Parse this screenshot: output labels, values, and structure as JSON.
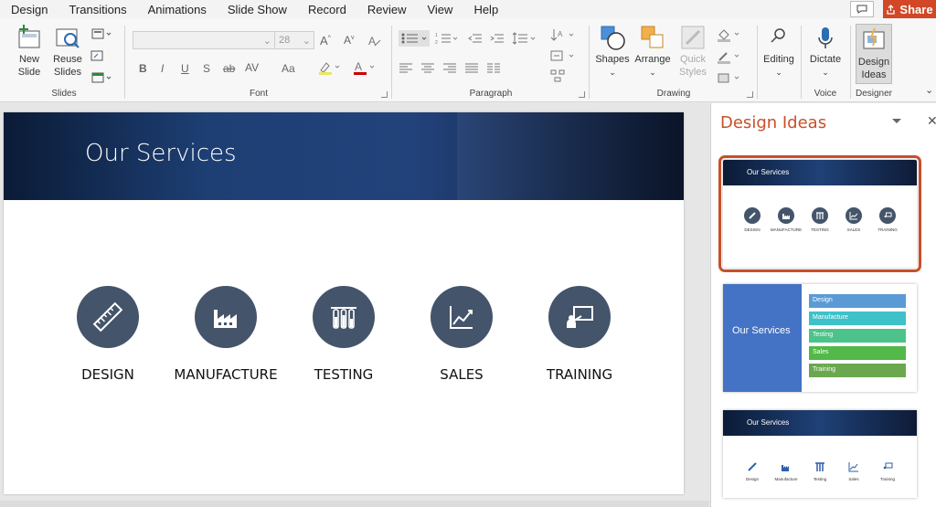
{
  "menu": {
    "items": [
      "Design",
      "Transitions",
      "Animations",
      "Slide Show",
      "Record",
      "Review",
      "View",
      "Help"
    ],
    "share_label": "Share"
  },
  "ribbon": {
    "slides_group": {
      "name": "Slides",
      "new_slide": "New Slide",
      "reuse_slides": "Reuse Slides"
    },
    "font_group": {
      "name": "Font",
      "font_size": "28",
      "bold": "B",
      "italic": "I",
      "underline": "U",
      "shadow": "S",
      "strike": "ab",
      "spacing": "AV",
      "case": "Aa"
    },
    "paragraph_group": {
      "name": "Paragraph"
    },
    "drawing_group": {
      "name": "Drawing",
      "shapes": "Shapes",
      "arrange": "Arrange",
      "quick_styles": "Quick Styles"
    },
    "editing_group": {
      "label": "Editing"
    },
    "voice_group": {
      "name": "Voice",
      "dictate": "Dictate"
    },
    "designer_group": {
      "name": "Designer",
      "design_ideas": "Design Ideas"
    }
  },
  "slide": {
    "title": "Our Services",
    "services": [
      {
        "label": "DESIGN",
        "icon": "ruler-icon"
      },
      {
        "label": "MANUFACTURE",
        "icon": "factory-icon"
      },
      {
        "label": "TESTING",
        "icon": "test-tubes-icon"
      },
      {
        "label": "SALES",
        "icon": "chart-icon"
      },
      {
        "label": "TRAINING",
        "icon": "presentation-icon"
      }
    ]
  },
  "pane": {
    "title": "Design Ideas",
    "thumb1": {
      "title": "Our Services",
      "labels": [
        "DESIGN",
        "MANUFACTURE",
        "TESTING",
        "SALES",
        "TRAINING"
      ]
    },
    "thumb2": {
      "title": "Our Services",
      "bars": [
        {
          "label": "Design",
          "color": "#5b9bd5"
        },
        {
          "label": "Manufacture",
          "color": "#3fc1c9"
        },
        {
          "label": "Testing",
          "color": "#4cc38a"
        },
        {
          "label": "Sales",
          "color": "#52b848"
        },
        {
          "label": "Training",
          "color": "#6aa84f"
        }
      ]
    },
    "thumb3": {
      "title": "Our Services",
      "labels": [
        "Design",
        "Manufacture",
        "Testing",
        "Sales",
        "Training"
      ]
    }
  },
  "colors": {
    "accent": "#c7502a",
    "icon_circle": "#44546a",
    "header_dark": "#0b1b36",
    "header_blue": "#1f4177",
    "thumb_blue": "#4472c4",
    "share": "#d24726"
  }
}
